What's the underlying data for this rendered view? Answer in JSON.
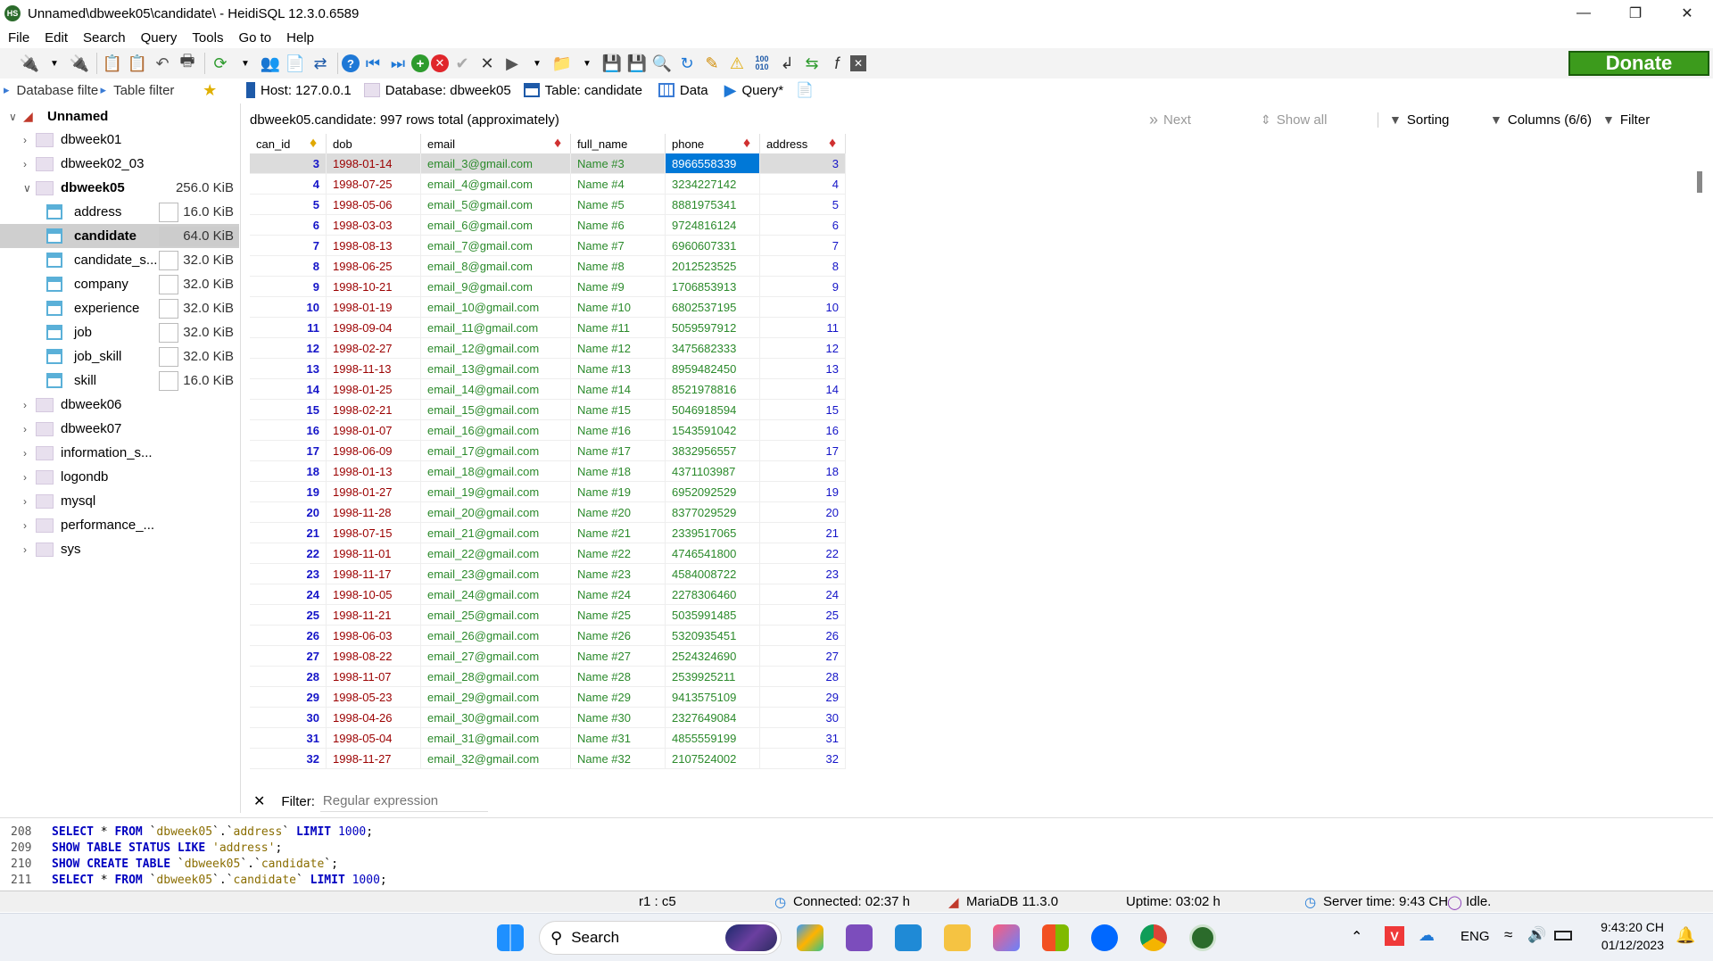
{
  "window": {
    "title": "Unnamed\\dbweek05\\candidate\\ - HeidiSQL 12.3.0.6589",
    "app_icon": "HS"
  },
  "menu": [
    "File",
    "Edit",
    "Search",
    "Query",
    "Tools",
    "Go to",
    "Help"
  ],
  "donate_label": "Donate",
  "filters": {
    "database_filter": "Database filte",
    "table_filter": "Table filter"
  },
  "tabs": [
    {
      "label": "Host: 127.0.0.1",
      "icon": "host-icon"
    },
    {
      "label": "Database: dbweek05",
      "icon": "database-icon"
    },
    {
      "label": "Table: candidate",
      "icon": "table-icon"
    },
    {
      "label": "Data",
      "icon": "grid-icon"
    },
    {
      "label": "Query*",
      "icon": "play-icon"
    }
  ],
  "tree": {
    "root": "Unnamed",
    "items": [
      {
        "label": "dbweek01",
        "type": "db"
      },
      {
        "label": "dbweek02_03",
        "type": "db"
      },
      {
        "label": "dbweek05",
        "type": "db",
        "size": "256.0 KiB",
        "expanded": true
      },
      {
        "label": "address",
        "type": "table",
        "size": "16.0 KiB"
      },
      {
        "label": "candidate",
        "type": "table",
        "size": "64.0 KiB",
        "selected": true
      },
      {
        "label": "candidate_s...",
        "type": "table",
        "size": "32.0 KiB"
      },
      {
        "label": "company",
        "type": "table",
        "size": "32.0 KiB"
      },
      {
        "label": "experience",
        "type": "table",
        "size": "32.0 KiB"
      },
      {
        "label": "job",
        "type": "table",
        "size": "32.0 KiB"
      },
      {
        "label": "job_skill",
        "type": "table",
        "size": "32.0 KiB"
      },
      {
        "label": "skill",
        "type": "table",
        "size": "16.0 KiB"
      },
      {
        "label": "dbweek06",
        "type": "db"
      },
      {
        "label": "dbweek07",
        "type": "db"
      },
      {
        "label": "information_s...",
        "type": "db"
      },
      {
        "label": "logondb",
        "type": "db"
      },
      {
        "label": "mysql",
        "type": "db"
      },
      {
        "label": "performance_...",
        "type": "db"
      },
      {
        "label": "sys",
        "type": "db"
      }
    ]
  },
  "grid_header": {
    "summary": "dbweek05.candidate: 997 rows total (approximately)",
    "next": "Next",
    "show_all": "Show all",
    "sorting": "Sorting",
    "columns": "Columns (6/6)",
    "filter": "Filter"
  },
  "columns": [
    "can_id",
    "dob",
    "email",
    "full_name",
    "phone",
    "address"
  ],
  "rows": [
    [
      "3",
      "1998-01-14",
      "email_3@gmail.com",
      "Name #3",
      "8966558339",
      "3"
    ],
    [
      "4",
      "1998-07-25",
      "email_4@gmail.com",
      "Name #4",
      "3234227142",
      "4"
    ],
    [
      "5",
      "1998-05-06",
      "email_5@gmail.com",
      "Name #5",
      "8881975341",
      "5"
    ],
    [
      "6",
      "1998-03-03",
      "email_6@gmail.com",
      "Name #6",
      "9724816124",
      "6"
    ],
    [
      "7",
      "1998-08-13",
      "email_7@gmail.com",
      "Name #7",
      "6960607331",
      "7"
    ],
    [
      "8",
      "1998-06-25",
      "email_8@gmail.com",
      "Name #8",
      "2012523525",
      "8"
    ],
    [
      "9",
      "1998-10-21",
      "email_9@gmail.com",
      "Name #9",
      "1706853913",
      "9"
    ],
    [
      "10",
      "1998-01-19",
      "email_10@gmail.com",
      "Name #10",
      "6802537195",
      "10"
    ],
    [
      "11",
      "1998-09-04",
      "email_11@gmail.com",
      "Name #11",
      "5059597912",
      "11"
    ],
    [
      "12",
      "1998-02-27",
      "email_12@gmail.com",
      "Name #12",
      "3475682333",
      "12"
    ],
    [
      "13",
      "1998-11-13",
      "email_13@gmail.com",
      "Name #13",
      "8959482450",
      "13"
    ],
    [
      "14",
      "1998-01-25",
      "email_14@gmail.com",
      "Name #14",
      "8521978816",
      "14"
    ],
    [
      "15",
      "1998-02-21",
      "email_15@gmail.com",
      "Name #15",
      "5046918594",
      "15"
    ],
    [
      "16",
      "1998-01-07",
      "email_16@gmail.com",
      "Name #16",
      "1543591042",
      "16"
    ],
    [
      "17",
      "1998-06-09",
      "email_17@gmail.com",
      "Name #17",
      "3832956557",
      "17"
    ],
    [
      "18",
      "1998-01-13",
      "email_18@gmail.com",
      "Name #18",
      "4371103987",
      "18"
    ],
    [
      "19",
      "1998-01-27",
      "email_19@gmail.com",
      "Name #19",
      "6952092529",
      "19"
    ],
    [
      "20",
      "1998-11-28",
      "email_20@gmail.com",
      "Name #20",
      "8377029529",
      "20"
    ],
    [
      "21",
      "1998-07-15",
      "email_21@gmail.com",
      "Name #21",
      "2339517065",
      "21"
    ],
    [
      "22",
      "1998-11-01",
      "email_22@gmail.com",
      "Name #22",
      "4746541800",
      "22"
    ],
    [
      "23",
      "1998-11-17",
      "email_23@gmail.com",
      "Name #23",
      "4584008722",
      "23"
    ],
    [
      "24",
      "1998-10-05",
      "email_24@gmail.com",
      "Name #24",
      "2278306460",
      "24"
    ],
    [
      "25",
      "1998-11-21",
      "email_25@gmail.com",
      "Name #25",
      "5035991485",
      "25"
    ],
    [
      "26",
      "1998-06-03",
      "email_26@gmail.com",
      "Name #26",
      "5320935451",
      "26"
    ],
    [
      "27",
      "1998-08-22",
      "email_27@gmail.com",
      "Name #27",
      "2524324690",
      "27"
    ],
    [
      "28",
      "1998-11-07",
      "email_28@gmail.com",
      "Name #28",
      "2539925211",
      "28"
    ],
    [
      "29",
      "1998-05-23",
      "email_29@gmail.com",
      "Name #29",
      "9413575109",
      "29"
    ],
    [
      "30",
      "1998-04-26",
      "email_30@gmail.com",
      "Name #30",
      "2327649084",
      "30"
    ],
    [
      "31",
      "1998-05-04",
      "email_31@gmail.com",
      "Name #31",
      "4855559199",
      "31"
    ],
    [
      "32",
      "1998-11-27",
      "email_32@gmail.com",
      "Name #32",
      "2107524002",
      "32"
    ]
  ],
  "filter_row": {
    "label": "Filter:",
    "placeholder": "Regular expression"
  },
  "sql_log": [
    {
      "line": "208",
      "parts": [
        [
          "kw",
          "SELECT"
        ],
        [
          "t",
          " * "
        ],
        [
          "kw",
          "FROM"
        ],
        [
          "t",
          " `"
        ],
        [
          "str",
          "dbweek05"
        ],
        [
          "t",
          "`.`"
        ],
        [
          "str",
          "address"
        ],
        [
          "t",
          "` "
        ],
        [
          "kw",
          "LIMIT"
        ],
        [
          "t",
          " "
        ],
        [
          "num",
          "1000"
        ],
        [
          "t",
          ";"
        ]
      ]
    },
    {
      "line": "209",
      "parts": [
        [
          "kw",
          "SHOW TABLE STATUS LIKE"
        ],
        [
          "t",
          " "
        ],
        [
          "str",
          "'address'"
        ],
        [
          "t",
          ";"
        ]
      ]
    },
    {
      "line": "210",
      "parts": [
        [
          "kw",
          "SHOW CREATE TABLE"
        ],
        [
          "t",
          " `"
        ],
        [
          "str",
          "dbweek05"
        ],
        [
          "t",
          "`.`"
        ],
        [
          "str",
          "candidate"
        ],
        [
          "t",
          "`;"
        ]
      ]
    },
    {
      "line": "211",
      "parts": [
        [
          "kw",
          "SELECT"
        ],
        [
          "t",
          " * "
        ],
        [
          "kw",
          "FROM"
        ],
        [
          "t",
          " `"
        ],
        [
          "str",
          "dbweek05"
        ],
        [
          "t",
          "`.`"
        ],
        [
          "str",
          "candidate"
        ],
        [
          "t",
          "` "
        ],
        [
          "kw",
          "LIMIT"
        ],
        [
          "t",
          " "
        ],
        [
          "num",
          "1000"
        ],
        [
          "t",
          ";"
        ]
      ]
    }
  ],
  "status": {
    "position": "r1 : c5",
    "connected": "Connected: 02:37 h",
    "server": "MariaDB 11.3.0",
    "uptime": "Uptime: 03:02 h",
    "server_time": "Server time: 9:43 CH",
    "state": "Idle."
  },
  "taskbar": {
    "search": "Search",
    "lang": "ENG",
    "time": "9:43:20 CH",
    "date": "01/12/2023"
  },
  "colors": {
    "accent": "#0078d7",
    "selected_cell": "#0078d7",
    "donate": "#3c9b1c"
  }
}
